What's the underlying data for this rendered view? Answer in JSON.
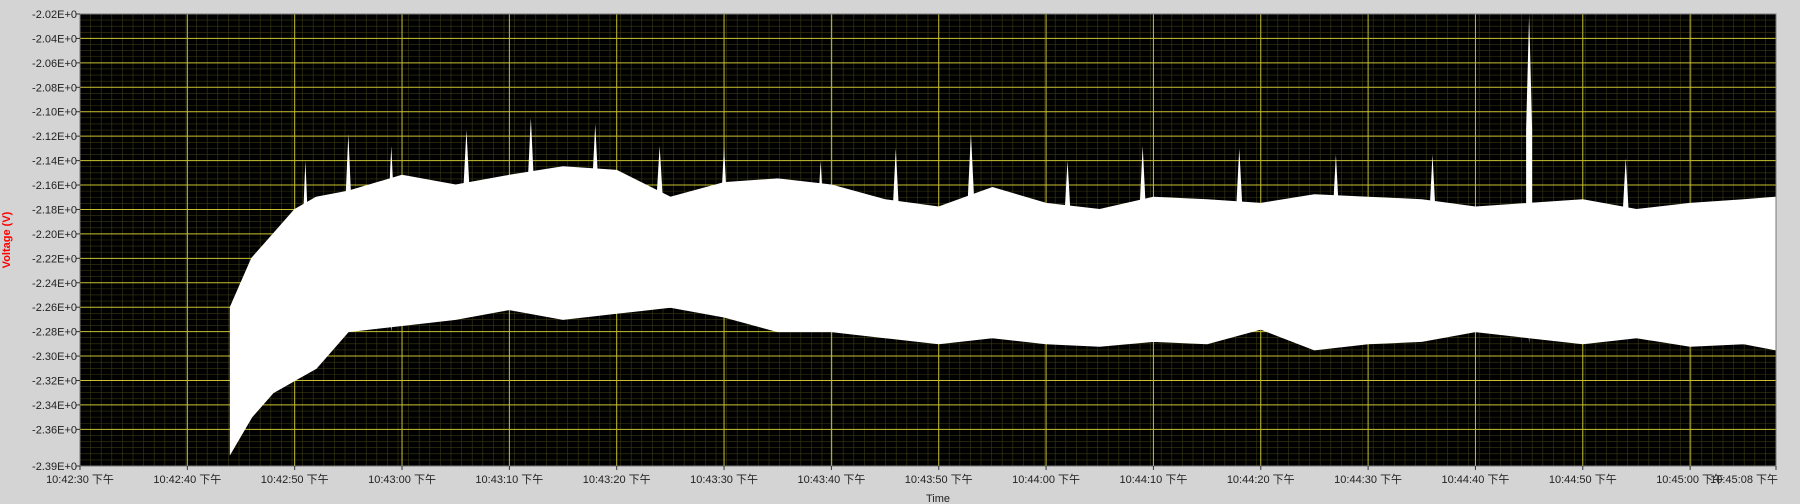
{
  "chart_data": {
    "type": "area",
    "title": "",
    "xlabel": "Time",
    "ylabel": "Voltage (V)",
    "ylim": [
      -2.39,
      -2.02
    ],
    "xlim_seconds_labels": [
      "10:42:30 下午",
      "10:45:08 下午"
    ],
    "y_ticks": [
      {
        "value": -2.02,
        "label": "-2.02E+0"
      },
      {
        "value": -2.04,
        "label": "-2.04E+0"
      },
      {
        "value": -2.06,
        "label": "-2.06E+0"
      },
      {
        "value": -2.08,
        "label": "-2.08E+0"
      },
      {
        "value": -2.1,
        "label": "-2.10E+0"
      },
      {
        "value": -2.12,
        "label": "-2.12E+0"
      },
      {
        "value": -2.14,
        "label": "-2.14E+0"
      },
      {
        "value": -2.16,
        "label": "-2.16E+0"
      },
      {
        "value": -2.18,
        "label": "-2.18E+0"
      },
      {
        "value": -2.2,
        "label": "-2.20E+0"
      },
      {
        "value": -2.22,
        "label": "-2.22E+0"
      },
      {
        "value": -2.24,
        "label": "-2.24E+0"
      },
      {
        "value": -2.26,
        "label": "-2.26E+0"
      },
      {
        "value": -2.28,
        "label": "-2.28E+0"
      },
      {
        "value": -2.3,
        "label": "-2.30E+0"
      },
      {
        "value": -2.32,
        "label": "-2.32E+0"
      },
      {
        "value": -2.34,
        "label": "-2.34E+0"
      },
      {
        "value": -2.36,
        "label": "-2.36E+0"
      },
      {
        "value": -2.39,
        "label": "-2.39E+0"
      }
    ],
    "x_ticks": [
      {
        "value": "10:42:30",
        "label": "10:42:30 下午"
      },
      {
        "value": "10:42:40",
        "label": "10:42:40 下午"
      },
      {
        "value": "10:42:50",
        "label": "10:42:50 下午"
      },
      {
        "value": "10:43:00",
        "label": "10:43:00 下午"
      },
      {
        "value": "10:43:10",
        "label": "10:43:10 下午"
      },
      {
        "value": "10:43:20",
        "label": "10:43:20 下午"
      },
      {
        "value": "10:43:30",
        "label": "10:43:30 下午"
      },
      {
        "value": "10:43:40",
        "label": "10:43:40 下午"
      },
      {
        "value": "10:43:50",
        "label": "10:43:50 下午"
      },
      {
        "value": "10:44:00",
        "label": "10:44:00 下午"
      },
      {
        "value": "10:44:10",
        "label": "10:44:10 下午"
      },
      {
        "value": "10:44:20",
        "label": "10:44:20 下午"
      },
      {
        "value": "10:44:30",
        "label": "10:44:30 下午"
      },
      {
        "value": "10:44:40",
        "label": "10:44:40 下午"
      },
      {
        "value": "10:44:50",
        "label": "10:44:50 下午"
      },
      {
        "value": "10:45:00",
        "label": "10:45:00 下午"
      },
      {
        "value": "10:45:08",
        "label": "10:45:08 下午"
      }
    ],
    "grid": true,
    "colors": {
      "plot_background": "#000000",
      "signal": "#ffffff",
      "major_grid": "#c8c030",
      "minor_grid": "#3a3a14",
      "ylabel": "#ff0000",
      "frame": "#d4d4d4"
    },
    "series": [
      {
        "band": [
          {
            "x": "10:42:44",
            "upper": -2.26,
            "lower": -2.38
          },
          {
            "x": "10:42:46",
            "upper": -2.22,
            "lower": -2.35
          },
          {
            "x": "10:42:48",
            "upper": -2.2,
            "lower": -2.33
          },
          {
            "x": "10:42:50",
            "upper": -2.18,
            "lower": -2.32
          },
          {
            "x": "10:42:52",
            "upper": -2.17,
            "lower": -2.31
          },
          {
            "x": "10:42:55",
            "upper": -2.165,
            "lower": -2.28
          },
          {
            "x": "10:43:00",
            "upper": -2.152,
            "lower": -2.275
          },
          {
            "x": "10:43:05",
            "upper": -2.16,
            "lower": -2.27
          },
          {
            "x": "10:43:10",
            "upper": -2.152,
            "lower": -2.262
          },
          {
            "x": "10:43:15",
            "upper": -2.145,
            "lower": -2.27
          },
          {
            "x": "10:43:20",
            "upper": -2.148,
            "lower": -2.265
          },
          {
            "x": "10:43:25",
            "upper": -2.17,
            "lower": -2.26
          },
          {
            "x": "10:43:30",
            "upper": -2.158,
            "lower": -2.268
          },
          {
            "x": "10:43:35",
            "upper": -2.155,
            "lower": -2.28
          },
          {
            "x": "10:43:40",
            "upper": -2.16,
            "lower": -2.28
          },
          {
            "x": "10:43:45",
            "upper": -2.172,
            "lower": -2.285
          },
          {
            "x": "10:43:50",
            "upper": -2.178,
            "lower": -2.29
          },
          {
            "x": "10:43:55",
            "upper": -2.162,
            "lower": -2.285
          },
          {
            "x": "10:44:00",
            "upper": -2.175,
            "lower": -2.29
          },
          {
            "x": "10:44:05",
            "upper": -2.18,
            "lower": -2.292
          },
          {
            "x": "10:44:10",
            "upper": -2.17,
            "lower": -2.288
          },
          {
            "x": "10:44:15",
            "upper": -2.172,
            "lower": -2.29
          },
          {
            "x": "10:44:20",
            "upper": -2.175,
            "lower": -2.278
          },
          {
            "x": "10:44:25",
            "upper": -2.168,
            "lower": -2.295
          },
          {
            "x": "10:44:30",
            "upper": -2.17,
            "lower": -2.29
          },
          {
            "x": "10:44:35",
            "upper": -2.172,
            "lower": -2.288
          },
          {
            "x": "10:44:40",
            "upper": -2.178,
            "lower": -2.28
          },
          {
            "x": "10:44:45",
            "upper": -2.175,
            "lower": -2.285
          },
          {
            "x": "10:44:50",
            "upper": -2.172,
            "lower": -2.29
          },
          {
            "x": "10:44:55",
            "upper": -2.18,
            "lower": -2.285
          },
          {
            "x": "10:45:00",
            "upper": -2.175,
            "lower": -2.292
          },
          {
            "x": "10:45:05",
            "upper": -2.172,
            "lower": -2.29
          },
          {
            "x": "10:45:08",
            "upper": -2.17,
            "lower": -2.295
          }
        ],
        "spikes": [
          {
            "x": "10:42:51",
            "top": -2.14,
            "bottom": -2.31
          },
          {
            "x": "10:42:55",
            "top": -2.118,
            "bottom": -2.28
          },
          {
            "x": "10:42:59",
            "top": -2.128,
            "bottom": -2.28
          },
          {
            "x": "10:43:06",
            "top": -2.115,
            "bottom": -2.25
          },
          {
            "x": "10:43:12",
            "top": -2.105,
            "bottom": -2.252
          },
          {
            "x": "10:43:18",
            "top": -2.11,
            "bottom": -2.25
          },
          {
            "x": "10:43:24",
            "top": -2.128,
            "bottom": -2.245
          },
          {
            "x": "10:43:30",
            "top": -2.128,
            "bottom": -2.265
          },
          {
            "x": "10:43:39",
            "top": -2.14,
            "bottom": -2.265
          },
          {
            "x": "10:43:46",
            "top": -2.13,
            "bottom": -2.27
          },
          {
            "x": "10:43:53",
            "top": -2.118,
            "bottom": -2.262
          },
          {
            "x": "10:44:02",
            "top": -2.14,
            "bottom": -2.265
          },
          {
            "x": "10:44:09",
            "top": -2.128,
            "bottom": -2.27
          },
          {
            "x": "10:44:18",
            "top": -2.13,
            "bottom": -2.265
          },
          {
            "x": "10:44:27",
            "top": -2.135,
            "bottom": -2.268
          },
          {
            "x": "10:44:36",
            "top": -2.135,
            "bottom": -2.27
          },
          {
            "x": "10:44:45",
            "top": -2.02,
            "bottom": -2.29
          },
          {
            "x": "10:44:54",
            "top": -2.138,
            "bottom": -2.265
          }
        ]
      }
    ]
  }
}
